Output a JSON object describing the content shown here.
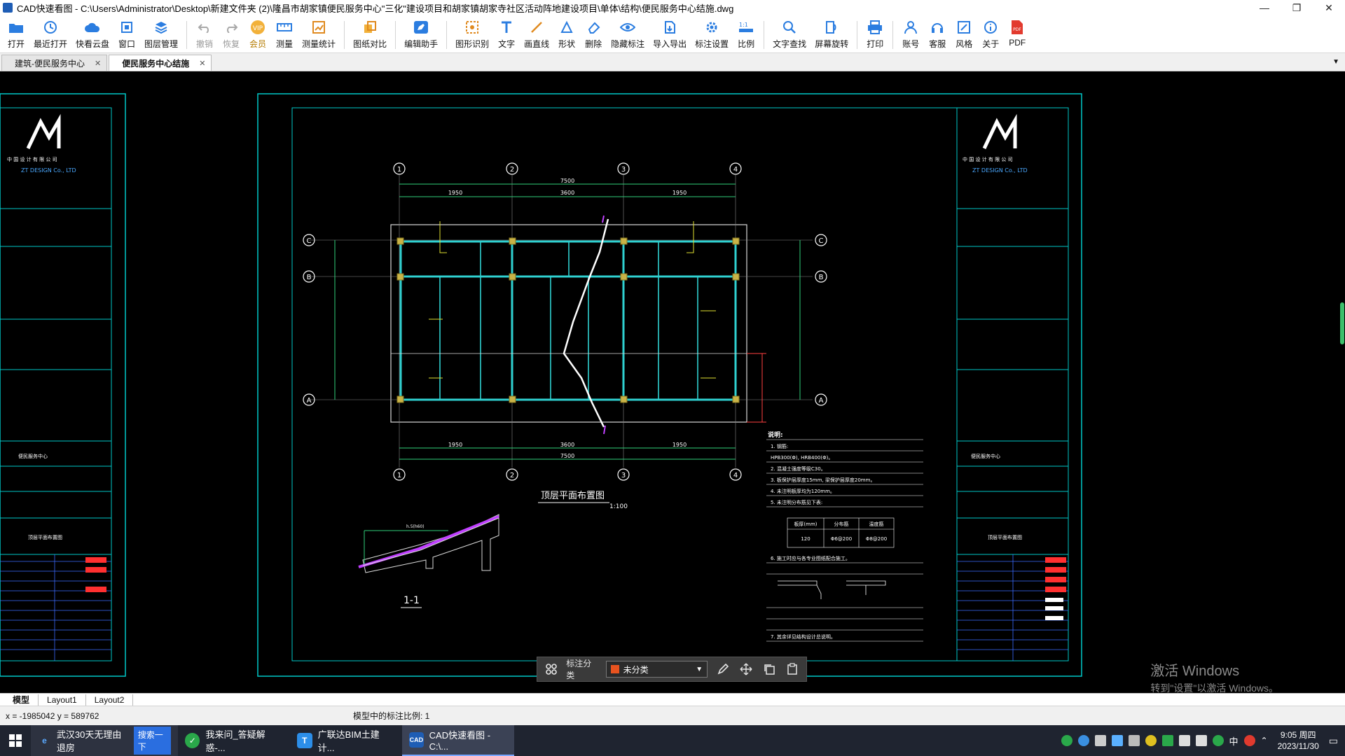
{
  "window": {
    "title": "CAD快速看图 - C:\\Users\\Administrator\\Desktop\\新建文件夹 (2)\\隆昌市胡家镇便民服务中心\"三化\"建设项目和胡家镇胡家寺社区活动阵地建设项目\\单体\\结构\\便民服务中心结施.dwg",
    "controls": [
      "—",
      "❐",
      "✕"
    ]
  },
  "toolbar": {
    "items": [
      {
        "id": "open",
        "label": "打开",
        "icon": "folder-icon"
      },
      {
        "id": "recent",
        "label": "最近打开",
        "icon": "history-icon"
      },
      {
        "id": "cloud",
        "label": "快看云盘",
        "icon": "cloud-icon"
      },
      {
        "id": "window",
        "label": "窗口",
        "icon": "window-icon"
      },
      {
        "id": "layers",
        "label": "图层管理",
        "icon": "layers-icon"
      },
      {
        "id": "undo",
        "label": "撤销",
        "icon": "undo-icon",
        "disabled": true
      },
      {
        "id": "redo",
        "label": "恢复",
        "icon": "redo-icon",
        "disabled": true
      },
      {
        "id": "vip",
        "label": "会员",
        "icon": "vip-icon"
      },
      {
        "id": "measure",
        "label": "测量",
        "icon": "ruler-icon"
      },
      {
        "id": "measure-stats",
        "label": "测量统计",
        "icon": "stats-icon"
      },
      {
        "id": "compare",
        "label": "图纸对比",
        "icon": "compare-icon"
      },
      {
        "id": "edit-helper",
        "label": "编辑助手",
        "icon": "edit-icon"
      },
      {
        "id": "shape-recog",
        "label": "图形识别",
        "icon": "recognize-icon"
      },
      {
        "id": "text",
        "label": "文字",
        "icon": "text-icon"
      },
      {
        "id": "line",
        "label": "画直线",
        "icon": "line-icon"
      },
      {
        "id": "shape",
        "label": "形状",
        "icon": "shape-icon"
      },
      {
        "id": "erase",
        "label": "删除",
        "icon": "eraser-icon"
      },
      {
        "id": "hide-anno",
        "label": "隐藏标注",
        "icon": "eye-icon"
      },
      {
        "id": "import-export",
        "label": "导入导出",
        "icon": "export-icon"
      },
      {
        "id": "anno-settings",
        "label": "标注设置",
        "icon": "gear-icon"
      },
      {
        "id": "scale",
        "label": "比例",
        "icon": "scale-icon"
      },
      {
        "id": "find-text",
        "label": "文字查找",
        "icon": "search-icon"
      },
      {
        "id": "rotate",
        "label": "屏幕旋转",
        "icon": "rotate-icon"
      },
      {
        "id": "print",
        "label": "打印",
        "icon": "printer-icon"
      },
      {
        "id": "account",
        "label": "账号",
        "icon": "user-icon"
      },
      {
        "id": "support",
        "label": "客服",
        "icon": "headset-icon"
      },
      {
        "id": "style",
        "label": "风格",
        "icon": "style-icon"
      },
      {
        "id": "about",
        "label": "关于",
        "icon": "info-icon"
      },
      {
        "id": "pdf",
        "label": "PDF",
        "icon": "pdf-icon"
      }
    ]
  },
  "tabs": [
    {
      "label": "建筑-便民服务中心",
      "active": false
    },
    {
      "label": "便民服务中心结施",
      "active": true
    }
  ],
  "drawing": {
    "axis_cols": [
      "1",
      "2",
      "3",
      "4"
    ],
    "axis_rows": [
      "C",
      "B",
      "A"
    ],
    "plan_title": "顶层平面布置图",
    "plan_scale": "1:100",
    "section_label": "1-1",
    "company_en": "ZT DESIGN Co., LTD",
    "project_name": "便民服务中心",
    "sheet_name": "顶层平面布置图",
    "notes_title": "说明:",
    "notes": [
      "1. 钢筋:",
      "   HPB300(Φ), HRB400(Φ)。",
      "2. 混凝土强度等级C30。",
      "3. 板保护层厚度15mm, 梁保护层厚度20mm。",
      "4. 未注明板厚均为120mm。",
      "5. 未注明分布筋见下表:",
      "6. 施工时应与各专业图纸配合施工。",
      "7. 其余详见结构设计总说明。"
    ],
    "notes_table": {
      "headers": [
        "板厚(mm)",
        "分布筋",
        "温度筋"
      ],
      "row": [
        "120",
        "Φ6@200",
        "Φ8@200"
      ]
    },
    "dims_top": [
      "1950",
      "3600",
      "1950"
    ],
    "dim_total": "7500"
  },
  "float_toolbar": {
    "label": "标注分类",
    "select_value": "未分类"
  },
  "watermark": {
    "line1": "激活 Windows",
    "line2": "转到\"设置\"以激活 Windows。"
  },
  "layout_tabs": [
    "模型",
    "Layout1",
    "Layout2"
  ],
  "status": {
    "coords": "x = -1985042  y = 589762",
    "scale_text": "模型中的标注比例: 1"
  },
  "taskbar": {
    "browser_text": "武汉30天无理由退房",
    "browser_search": "搜索一下",
    "apps": [
      {
        "label": "我来问_答疑解惑-...",
        "icon": "chat-icon",
        "color": "#2aa84a"
      },
      {
        "label": "广联达BIM土建计...",
        "icon": "glodon-icon",
        "color": "#2c8ee8"
      },
      {
        "label": "CAD快速看图 - C:\\...",
        "icon": "cad-icon",
        "color": "#1e5db5"
      }
    ],
    "time": "9:05 周四",
    "date": "2023/11/30",
    "ime": "中"
  }
}
